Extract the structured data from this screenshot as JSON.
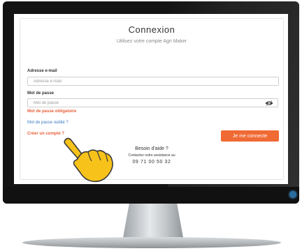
{
  "login": {
    "title": "Connexion",
    "subtitle": "Utilisez votre compte Agri Maker",
    "email_label": "Adresse e-mail",
    "email_placeholder": "Adresse e-mail",
    "email_value": "",
    "password_label": "Mot de passe",
    "password_placeholder": "Mot de passe",
    "password_value": "",
    "password_error": "Mot de passe obligatoire",
    "forgot_link": "Mot de passe oublié ?",
    "signup_link": "Créer un compte ?",
    "submit_label": "Je me connecte"
  },
  "help": {
    "title": "Besoin d'aide ?",
    "subtitle": "Contactez notre assistance au",
    "phone": "09 71 00 50 32"
  },
  "icons": {
    "password_toggle": "eye-icon",
    "pointer": "pointing-hand-icon"
  },
  "colors": {
    "accent": "#f06a34",
    "error": "#e8603c",
    "link": "#3d7bc4",
    "hand": "#f7c21a"
  }
}
